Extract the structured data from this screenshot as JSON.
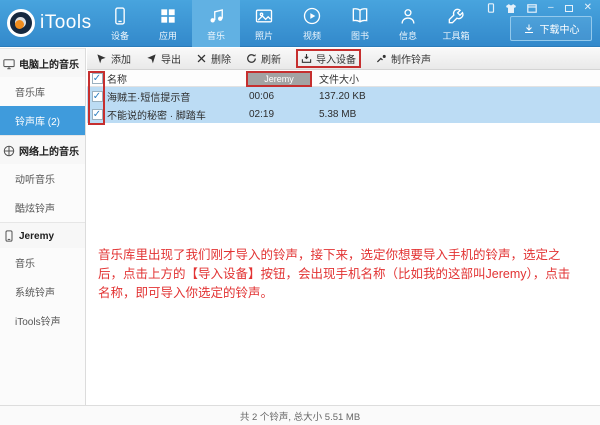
{
  "app": {
    "name": "iTools"
  },
  "nav": {
    "tabs": [
      {
        "label": "设备"
      },
      {
        "label": "应用"
      },
      {
        "label": "音乐",
        "active": true
      },
      {
        "label": "照片"
      },
      {
        "label": "视频"
      },
      {
        "label": "图书"
      },
      {
        "label": "信息"
      },
      {
        "label": "工具箱"
      }
    ],
    "download_button": "下载中心"
  },
  "toolbar": {
    "add": "添加",
    "export": "导出",
    "delete": "删除",
    "refresh": "刷新",
    "import_device": "导入设备",
    "make_ringtone": "制作铃声"
  },
  "sidebar": {
    "sections": [
      {
        "title": "电脑上的音乐",
        "items": [
          {
            "label": "音乐库"
          },
          {
            "label": "铃声库 (2)",
            "selected": true
          }
        ]
      },
      {
        "title": "网络上的音乐",
        "items": [
          {
            "label": "动听音乐"
          },
          {
            "label": "酷炫铃声"
          }
        ]
      },
      {
        "title": "Jeremy",
        "items": [
          {
            "label": "音乐"
          },
          {
            "label": "系统铃声"
          },
          {
            "label": "iTools铃声"
          }
        ]
      }
    ]
  },
  "table": {
    "columns": {
      "name": "名称",
      "size": "文件大小"
    },
    "device_button": "Jeremy",
    "check": "✓",
    "rows": [
      {
        "name": "海贼王·短信提示音",
        "duration": "00:06",
        "size": "137.20 KB"
      },
      {
        "name": "不能说的秘密 · 脚踏车",
        "duration": "02:19",
        "size": "5.38 MB"
      }
    ]
  },
  "annotation": {
    "lines": [
      "音乐库里出现了我们刚才导入的铃声，接下来，选定你想要导入手机的铃声，选定之",
      "后，点击上方的【导入设备】按钮，会出现手机名称（比如我的这部叫Jeremy），点击",
      "名称，即可导入你选定的铃声。"
    ]
  },
  "statusbar": {
    "text": "共 2 个铃声, 总大小 5.51 MB"
  },
  "colors": {
    "navbar_blue": "#3e97d5",
    "active_tab_blue": "#61b1e3",
    "row_selection_blue": "#bcdcf4",
    "sidebar_selected_blue": "#3f9bdc",
    "highlight_red": "#c62f2f",
    "annotation_red": "#e23333"
  }
}
